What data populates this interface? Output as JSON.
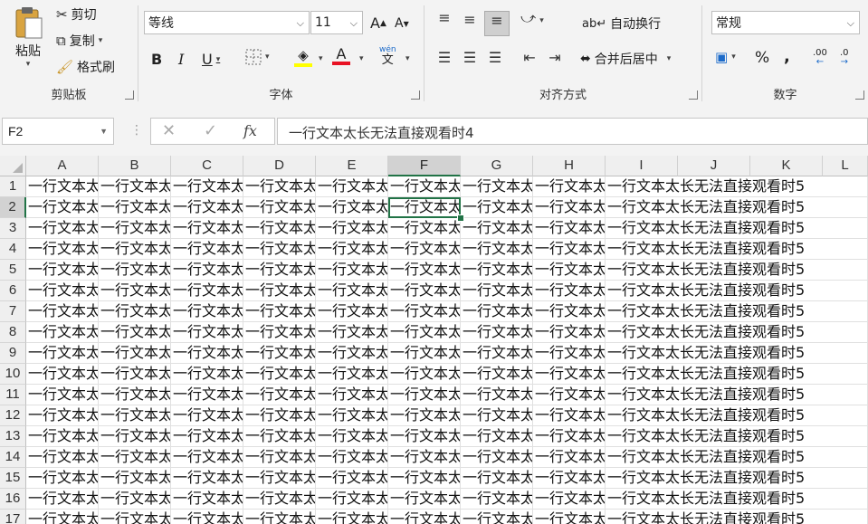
{
  "ribbon": {
    "clipboard": {
      "label": "剪贴板",
      "paste": "粘贴",
      "cut": "剪切",
      "copy": "复制",
      "format_painter": "格式刷"
    },
    "font": {
      "label": "字体",
      "font_name": "等线",
      "font_size": "11",
      "bold": "B",
      "italic": "I",
      "underline": "U",
      "grow": "A",
      "shrink": "A",
      "font_color_glyph": "A",
      "phonetic_glyph": "文",
      "phonetic_small": "wén"
    },
    "alignment": {
      "label": "对齐方式",
      "wrap_text": "自动换行",
      "merge_center": "合并后居中"
    },
    "number": {
      "label": "数字",
      "format": "常规",
      "percent": "%",
      "comma": ",",
      "inc_dec": ".00",
      "dec_dec": ".0"
    }
  },
  "formula_bar": {
    "name_box": "F2",
    "fx": "fx",
    "formula": "一行文本太长无法直接观看时4"
  },
  "grid": {
    "columns": [
      "A",
      "B",
      "C",
      "D",
      "E",
      "F",
      "G",
      "H",
      "I",
      "J",
      "K",
      "L"
    ],
    "selected_column": "F",
    "selected_row": "2",
    "rows": [
      {
        "n": "1",
        "short": "一行文本太",
        "long": "一行文本太长无法直接观看时5"
      },
      {
        "n": "2",
        "short": "一行文本太",
        "long": "一行文本太长无法直接观看时5"
      },
      {
        "n": "3",
        "short": "一行文本太",
        "long": "一行文本太长无法直接观看时5"
      },
      {
        "n": "4",
        "short": "一行文本太",
        "long": "一行文本太长无法直接观看时5"
      },
      {
        "n": "5",
        "short": "一行文本太",
        "long": "一行文本太长无法直接观看时5"
      },
      {
        "n": "6",
        "short": "一行文本太",
        "long": "一行文本太长无法直接观看时5"
      },
      {
        "n": "7",
        "short": "一行文本太",
        "long": "一行文本太长无法直接观看时5"
      },
      {
        "n": "8",
        "short": "一行文本太",
        "long": "一行文本太长无法直接观看时5"
      },
      {
        "n": "9",
        "short": "一行文本太",
        "long": "一行文本太长无法直接观看时5"
      },
      {
        "n": "10",
        "short": "一行文本太",
        "long": "一行文本太长无法直接观看时5"
      },
      {
        "n": "11",
        "short": "一行文本太",
        "long": "一行文本太长无法直接观看时5"
      },
      {
        "n": "12",
        "short": "一行文本太",
        "long": "一行文本太长无法直接观看时5"
      },
      {
        "n": "13",
        "short": "一行文本太",
        "long": "一行文本太长无法直接观看时5"
      },
      {
        "n": "14",
        "short": "一行文本太",
        "long": "一行文本太长无法直接观看时5"
      },
      {
        "n": "15",
        "short": "一行文本太",
        "long": "一行文本太长无法直接观看时5"
      },
      {
        "n": "16",
        "short": "一行文本太",
        "long": "一行文本太长无法直接观看时5"
      },
      {
        "n": "17",
        "short": "一行文本太",
        "long": "一行文本太长无法直接观看时5"
      }
    ]
  },
  "colors": {
    "accent": "#217346",
    "font_color_bar": "#e81123",
    "highlight_bar": "#ffff00"
  }
}
